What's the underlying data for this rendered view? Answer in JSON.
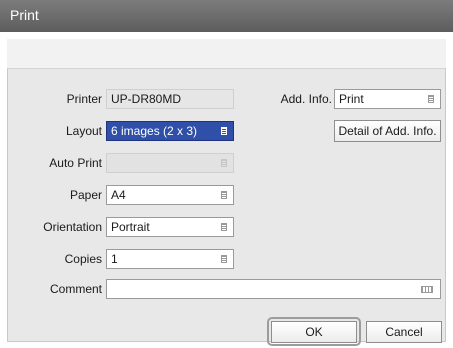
{
  "window": {
    "title": "Print"
  },
  "labels": {
    "printer": "Printer",
    "layout": "Layout",
    "auto_print": "Auto Print",
    "paper": "Paper",
    "orientation": "Orientation",
    "copies": "Copies",
    "comment": "Comment",
    "add_info": "Add. Info."
  },
  "values": {
    "printer": "UP-DR80MD",
    "layout": "6 images (2 x 3)",
    "auto_print": "",
    "paper": "A4",
    "orientation": "Portrait",
    "copies": "1",
    "comment": "",
    "add_info": "Print"
  },
  "buttons": {
    "detail_add_info": "Detail of Add. Info.",
    "ok": "OK",
    "cancel": "Cancel"
  },
  "colors": {
    "titlebar": "#6b6b6b",
    "selected": "#2f4fa8",
    "panel": "#e8e8e8"
  },
  "icons": {
    "dropdown": "dropdown-list-icon",
    "keyboard": "keyboard-icon"
  }
}
